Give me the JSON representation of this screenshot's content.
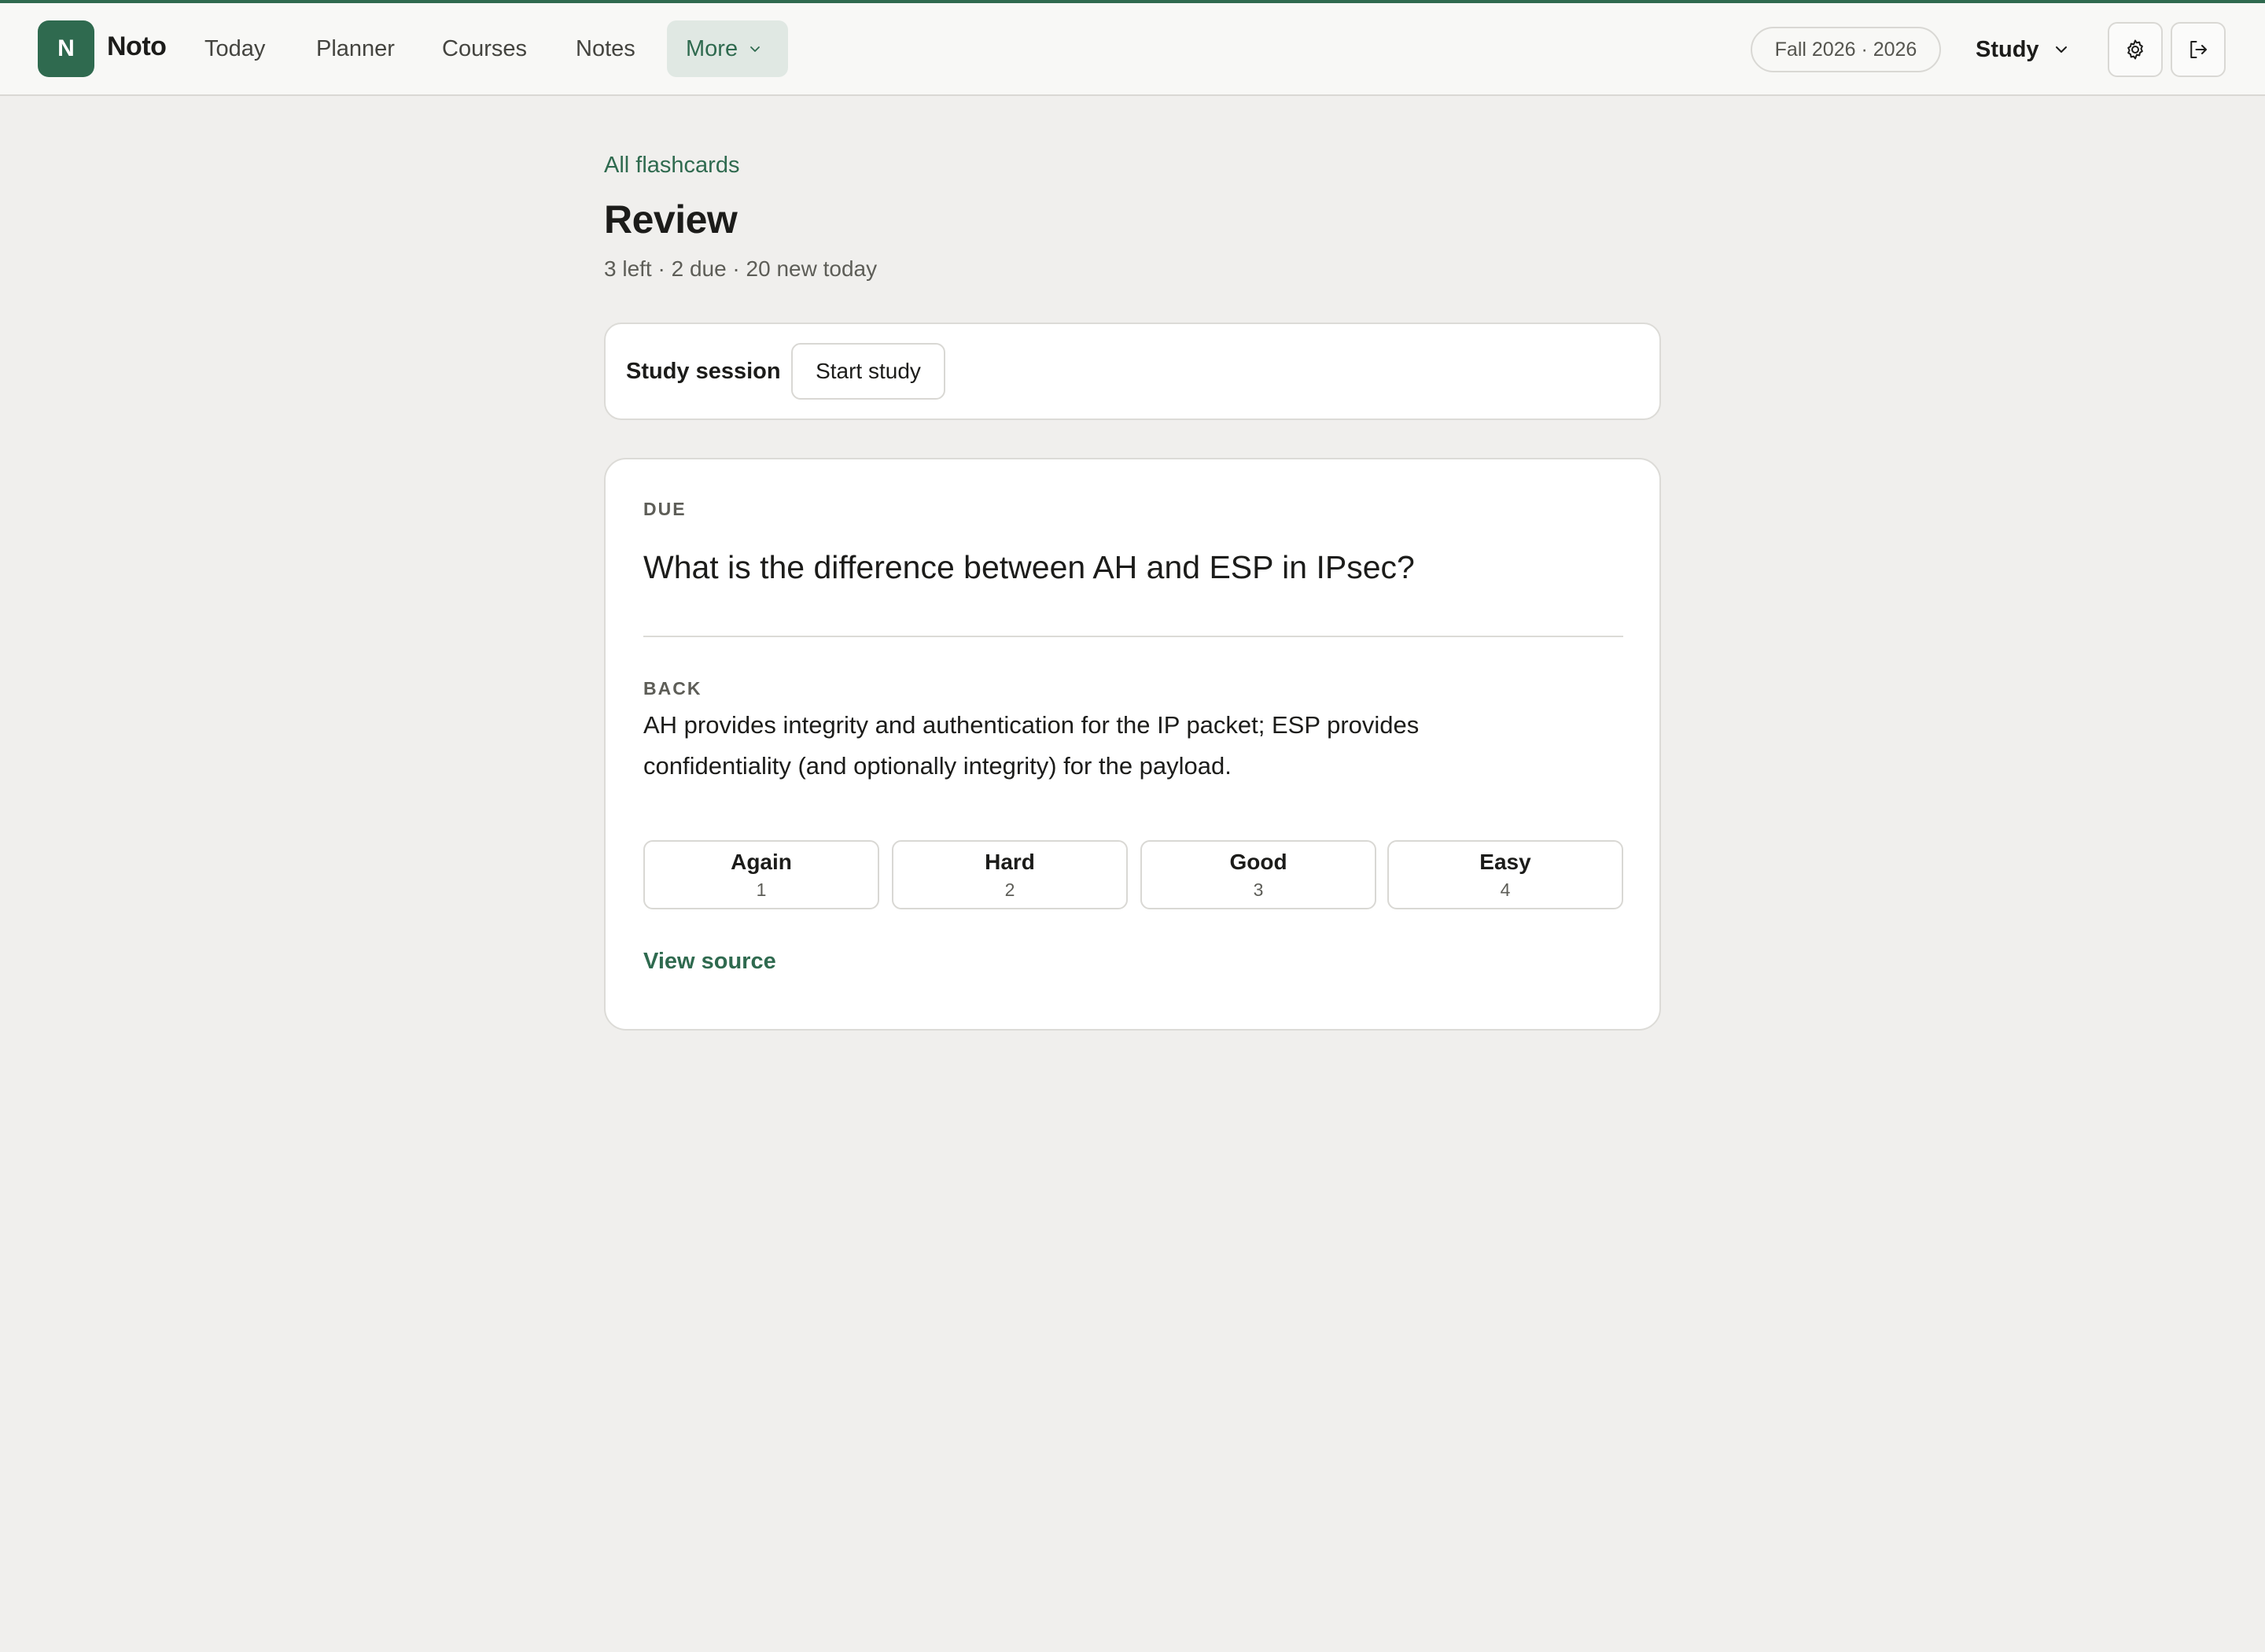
{
  "app": {
    "logo_letter": "N",
    "brand": "Noto"
  },
  "nav": {
    "items": [
      {
        "label": "Today"
      },
      {
        "label": "Planner"
      },
      {
        "label": "Courses"
      },
      {
        "label": "Notes"
      },
      {
        "label": "More"
      }
    ],
    "active": "More"
  },
  "header": {
    "term": "Fall 2026 · 2026",
    "mode": "Study",
    "settings_icon": "gear-icon",
    "logout_icon": "logout-icon"
  },
  "page": {
    "back_link": "All flashcards",
    "title": "Review",
    "subtitle": "3 left · 2 due · 20 new today"
  },
  "session": {
    "label": "Study session",
    "start_button": "Start study"
  },
  "card": {
    "status": "DUE",
    "question": "What is the difference between AH and ESP in IPsec?",
    "back_label": "BACK",
    "answer": "AH provides integrity and authentication for the IP packet; ESP provides confidentiality (and optionally integrity) for the payload.",
    "grades": [
      {
        "label": "Again",
        "key": "1"
      },
      {
        "label": "Hard",
        "key": "2"
      },
      {
        "label": "Good",
        "key": "3"
      },
      {
        "label": "Easy",
        "key": "4"
      }
    ],
    "view_source": "View source"
  },
  "colors": {
    "accent": "#2f6a4f",
    "background": "#f0efed",
    "nav_active_bg": "#e0e8e3"
  }
}
